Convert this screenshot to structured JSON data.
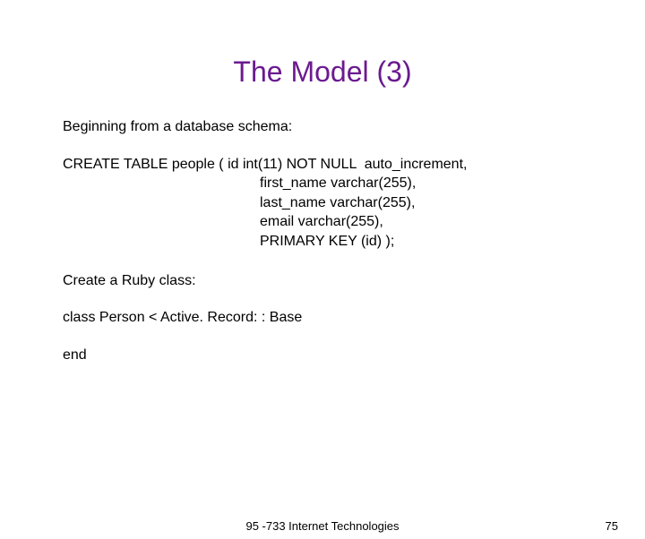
{
  "title": "The Model (3)",
  "intro": "Beginning from a database schema:",
  "sql": {
    "line1": "CREATE TABLE people ( id int(11) NOT NULL  auto_increment,",
    "line2": "first_name varchar(255),",
    "line3": "last_name varchar(255),",
    "line4": "email varchar(255),",
    "line5": "PRIMARY KEY (id) );"
  },
  "ruby_intro": "Create a Ruby class:",
  "ruby_class": "class Person < Active. Record: : Base",
  "ruby_end": "end",
  "footer": {
    "center": "95 -733 Internet Technologies",
    "page": "75"
  }
}
